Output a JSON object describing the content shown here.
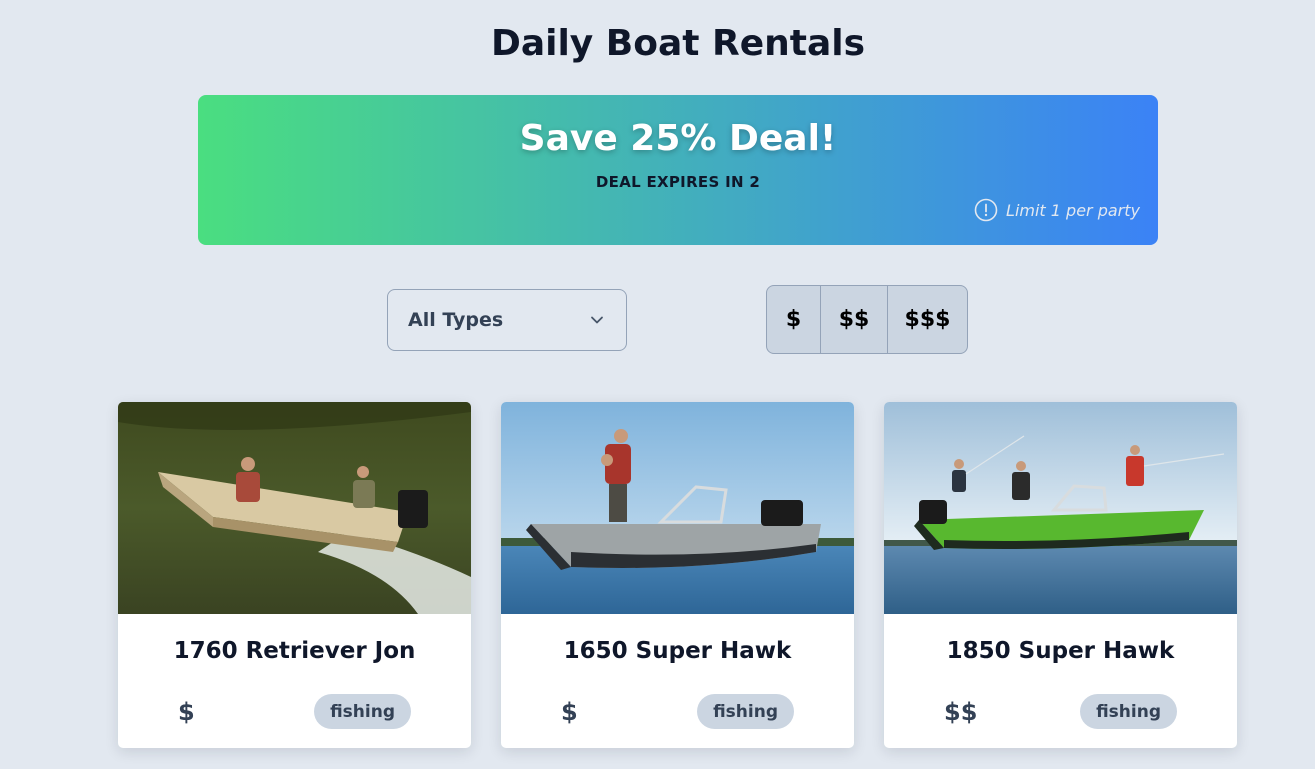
{
  "header": {
    "title": "Daily Boat Rentals"
  },
  "deal": {
    "title": "Save 25% Deal!",
    "expires": "DEAL EXPIRES IN 2",
    "limit": "Limit 1 per party",
    "icon": "info-icon"
  },
  "filters": {
    "type_select": {
      "selected": "All Types",
      "icon": "chevron-down-icon"
    },
    "price_options": [
      "$",
      "$$",
      "$$$"
    ]
  },
  "boats": [
    {
      "name": "1760 Retriever Jon",
      "price": "$",
      "tag": "fishing"
    },
    {
      "name": "1650 Super Hawk",
      "price": "$",
      "tag": "fishing"
    },
    {
      "name": "1850 Super Hawk",
      "price": "$$",
      "tag": "fishing"
    }
  ],
  "colors": {
    "background": "#e2e8f0",
    "gradient_start": "#4ade80",
    "gradient_end": "#3b82f6",
    "tag_bg": "#cbd5e1"
  }
}
